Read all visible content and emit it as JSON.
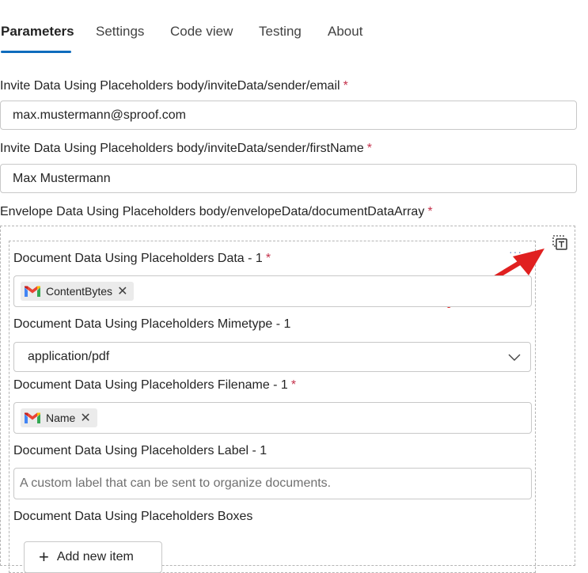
{
  "tabs": [
    {
      "label": "Parameters",
      "active": true
    },
    {
      "label": "Settings"
    },
    {
      "label": "Code view"
    },
    {
      "label": "Testing"
    },
    {
      "label": "About"
    }
  ],
  "required_mark": "*",
  "fields": {
    "sender_email": {
      "label": "Invite Data Using Placeholders body/inviteData/sender/email",
      "value": "max.mustermann@sproof.com"
    },
    "sender_first_name": {
      "label": "Invite Data Using Placeholders body/inviteData/sender/firstName",
      "value": "Max Mustermann"
    },
    "document_data_array": {
      "label": "Envelope Data Using Placeholders body/envelopeData/documentDataArray"
    }
  },
  "document_item": {
    "menu_dots": "···",
    "data": {
      "label": "Document Data Using Placeholders Data - 1",
      "token": {
        "label": "ContentBytes",
        "icon": "gmail-icon"
      }
    },
    "mimetype": {
      "label": "Document Data Using Placeholders Mimetype - 1",
      "value": "application/pdf"
    },
    "filename": {
      "label": "Document Data Using Placeholders Filename - 1",
      "token": {
        "label": "Name",
        "icon": "gmail-icon"
      }
    },
    "doc_label": {
      "label": "Document Data Using Placeholders Label - 1",
      "placeholder": "A custom label that can be sent to organize documents."
    },
    "boxes": {
      "label": "Document Data Using Placeholders Boxes",
      "add_button": "Add new item"
    }
  },
  "colors": {
    "accent": "#0f6cbd",
    "required": "#c4314b",
    "annotation_arrow": "#e02020"
  }
}
